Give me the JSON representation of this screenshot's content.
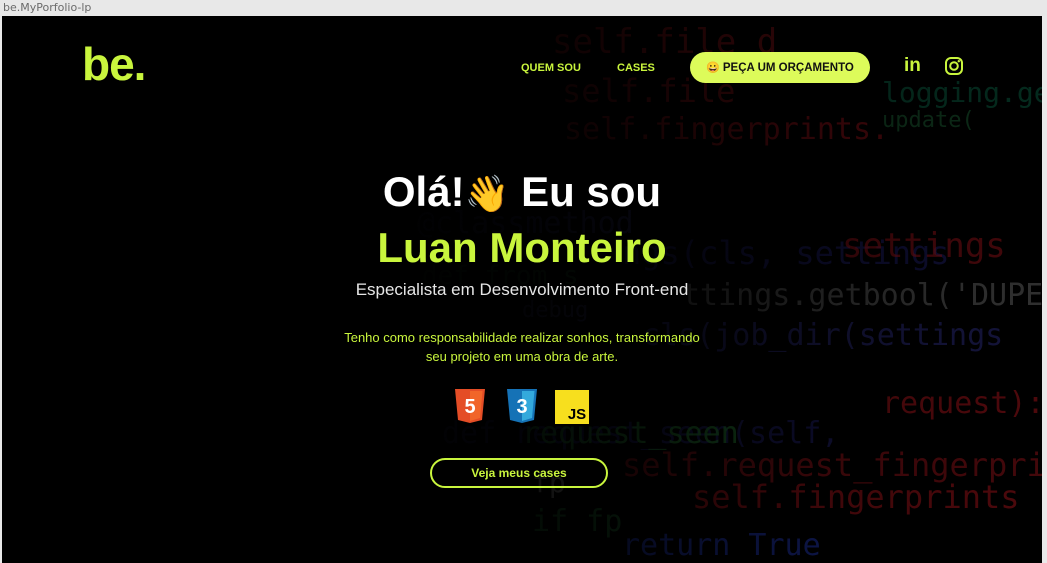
{
  "window": {
    "title": "be.MyPorfolio-lp"
  },
  "header": {
    "logo": "be.",
    "nav": [
      {
        "label": "QUEM SOU"
      },
      {
        "label": "CASES"
      }
    ],
    "budget_button": {
      "emoji": "😀",
      "label": "PEÇA UM ORÇAMENTO"
    },
    "social": [
      {
        "icon": "linkedin-icon",
        "glyph": "in"
      },
      {
        "icon": "instagram-icon"
      }
    ]
  },
  "hero": {
    "greeting": "Olá!",
    "wave": "👋",
    "greeting_suffix": "Eu sou",
    "name": "Luan Monteiro",
    "subtitle": "Especialista em Desenvolvimento Front-end",
    "description_line1": "Tenho como responsabilidade realizar sonhos, transformando",
    "description_line2": "seu projeto em uma obra de arte.",
    "tech": [
      {
        "icon": "html5-icon",
        "label": "5",
        "color": "#e44d26"
      },
      {
        "icon": "css3-icon",
        "label": "3",
        "color": "#1572b6"
      },
      {
        "icon": "javascript-icon",
        "label": "JS",
        "color": "#f7df1e"
      }
    ],
    "cta_label": "Veja meus cases"
  },
  "colors": {
    "accent": "#c9f53d",
    "button_bg": "#ddfb5a",
    "background": "#000000"
  }
}
